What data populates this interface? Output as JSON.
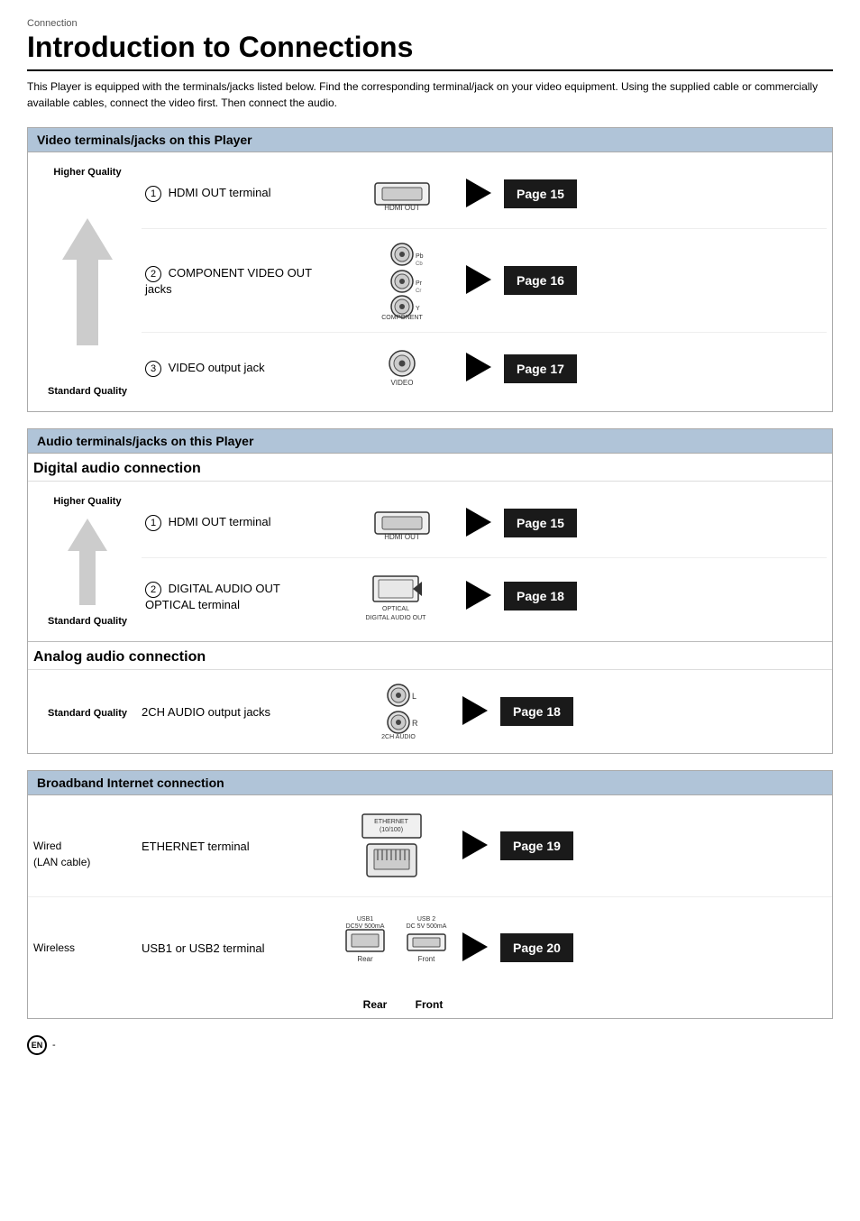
{
  "breadcrumb": "Connection",
  "title": "Introduction to Connections",
  "intro": "This Player is equipped with the terminals/jacks listed below. Find the corresponding terminal/jack on your video equipment. Using the supplied cable or commercially available cables, connect the video first. Then connect the audio.",
  "video_section": {
    "header": "Video terminals/jacks on this Player",
    "rows": [
      {
        "quality_top": "Higher Quality",
        "quality_bottom": "Standard Quality",
        "items": [
          {
            "num": "1",
            "name": "HDMI OUT terminal",
            "icon": "hdmi",
            "icon_label": "HDMI OUT",
            "page": "Page 15"
          },
          {
            "num": "2",
            "name": "COMPONENT VIDEO OUT\njacks",
            "icon": "component",
            "icon_label": "COMPONENT\nVIDEO OUT",
            "page": "Page 16"
          },
          {
            "num": "3",
            "name": "VIDEO output jack",
            "icon": "video",
            "icon_label": "VIDEO",
            "page": "Page 17"
          }
        ]
      }
    ]
  },
  "audio_section": {
    "header": "Audio terminals/jacks on this Player",
    "digital_title": "Digital audio connection",
    "digital_rows": [
      {
        "quality_top": "Higher Quality",
        "quality_bottom": "Standard Quality",
        "items": [
          {
            "num": "1",
            "name": "HDMI OUT terminal",
            "icon": "hdmi",
            "icon_label": "HDMI OUT",
            "page": "Page 15"
          },
          {
            "num": "2",
            "name": "DIGITAL AUDIO OUT\nOPTICAL terminal",
            "icon": "optical",
            "icon_label": "DIGITAL\nAUDIO OUT",
            "page": "Page 18"
          }
        ]
      }
    ],
    "analog_title": "Analog audio connection",
    "analog_rows": [
      {
        "quality": "Standard Quality",
        "name": "2CH AUDIO output jacks",
        "icon": "2ch",
        "icon_label": "2CH AUDIO",
        "page": "Page 18"
      }
    ]
  },
  "broadband_section": {
    "header": "Broadband Internet connection",
    "rows": [
      {
        "type_label": "Wired\n(LAN cable)",
        "name": "ETHERNET terminal",
        "icon": "ethernet",
        "icon_label": "ETHERNET\n(10/100)",
        "page": "Page 19"
      },
      {
        "type_label": "Wireless",
        "name": "USB1 or USB2 terminal",
        "icon": "usb",
        "icon_label": "USB1\nDC5V 500mA",
        "icon_label2": "USB 2\nDC 5V 500mA",
        "page": "Page 20",
        "note_rear": "Rear",
        "note_front": "Front"
      }
    ]
  },
  "footer": {
    "lang": "EN",
    "dash": "-"
  }
}
